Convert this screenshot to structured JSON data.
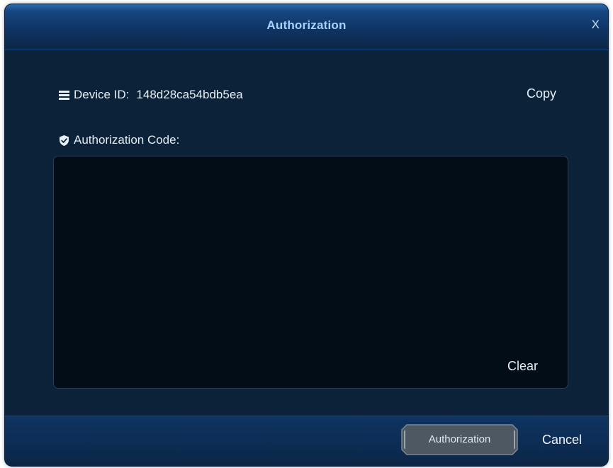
{
  "dialog": {
    "title": "Authorization",
    "close_label": "X"
  },
  "device": {
    "label": "Device ID:",
    "value": "148d28ca54bdb5ea",
    "icon": "list-icon",
    "copy_label": "Copy"
  },
  "auth_code": {
    "label": "Authorization Code:",
    "icon": "shield-check-icon",
    "value": "",
    "clear_label": "Clear"
  },
  "footer": {
    "authorize_label": "Authorization",
    "cancel_label": "Cancel"
  },
  "colors": {
    "background": "#0b2238",
    "title_text": "#a9d1ff",
    "input_bg": "#020d17"
  }
}
